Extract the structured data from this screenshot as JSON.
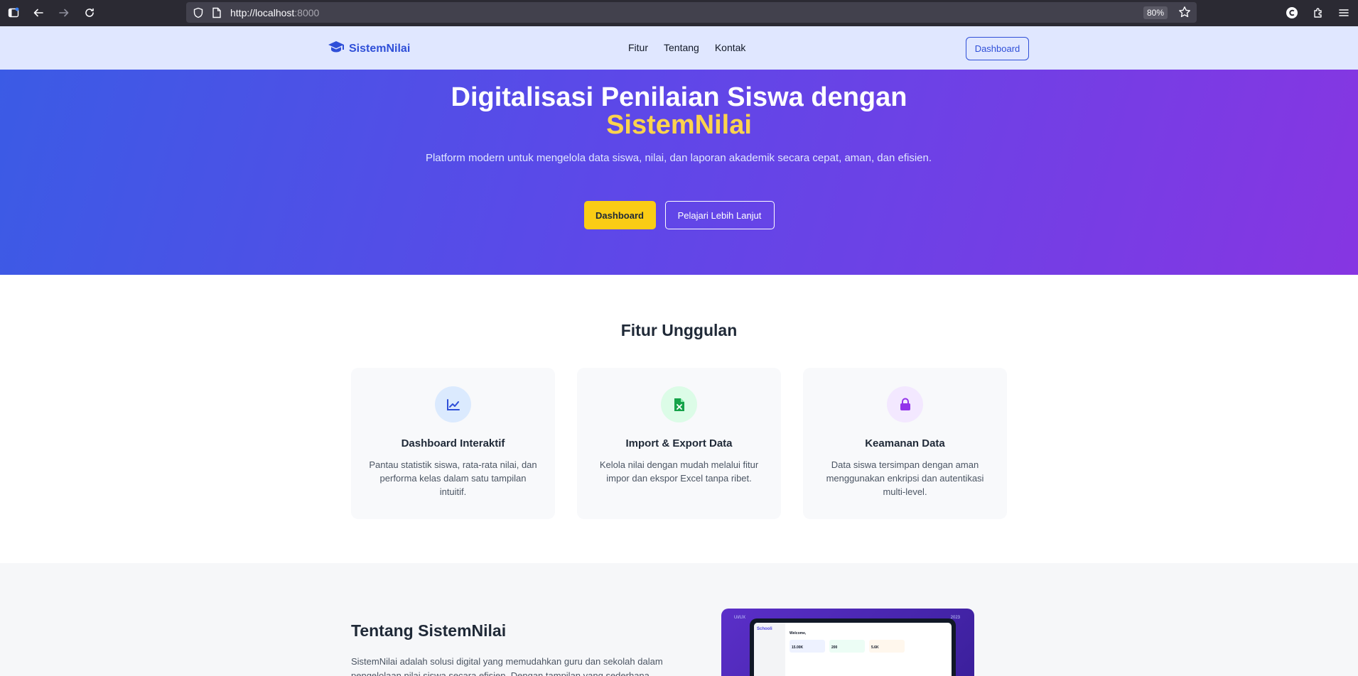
{
  "browser": {
    "url_host": "http://localhost",
    "url_port": ":8000",
    "zoom": "80%"
  },
  "nav": {
    "brand": "SistemNilai",
    "links": [
      "Fitur",
      "Tentang",
      "Kontak"
    ],
    "dashboard_button": "Dashboard"
  },
  "hero": {
    "title": "Digitalisasi Penilaian Siswa dengan",
    "title_highlight": "SistemNilai",
    "subtitle": "Platform modern untuk mengelola data siswa, nilai, dan laporan akademik secara cepat, aman, dan efisien.",
    "primary_button": "Dashboard",
    "secondary_button": "Pelajari Lebih Lanjut"
  },
  "features": {
    "title": "Fitur Unggulan",
    "items": [
      {
        "icon": "chart-line-icon",
        "title": "Dashboard Interaktif",
        "description": "Pantau statistik siswa, rata-rata nilai, dan performa kelas dalam satu tampilan intuitif."
      },
      {
        "icon": "file-excel-icon",
        "title": "Import & Export Data",
        "description": "Kelola nilai dengan mudah melalui fitur impor dan ekspor Excel tanpa ribet."
      },
      {
        "icon": "lock-icon",
        "title": "Keamanan Data",
        "description": "Data siswa tersimpan dengan aman menggunakan enkripsi dan autentikasi multi-level."
      }
    ]
  },
  "about": {
    "title": "Tentang SistemNilai",
    "text": "SistemNilai adalah solusi digital yang memudahkan guru dan sekolah dalam pengelolaan nilai siswa secara efisien. Dengan tampilan yang sederhana, data"
  },
  "mockup": {
    "brand": "Schooli",
    "welcome": "Welcome,",
    "stats": [
      "15.00K",
      "200",
      "5.6K"
    ],
    "corner_left": "UI/UX",
    "corner_right": "2023"
  },
  "colors": {
    "brand": "#2f4fd8",
    "hero_start": "#3b5be5",
    "hero_end": "#8636e2",
    "accent_yellow": "#facc15",
    "feature_blue_bg": "#dbeafe",
    "feature_green_bg": "#dcfce7",
    "feature_purple_bg": "#f3e8ff"
  }
}
